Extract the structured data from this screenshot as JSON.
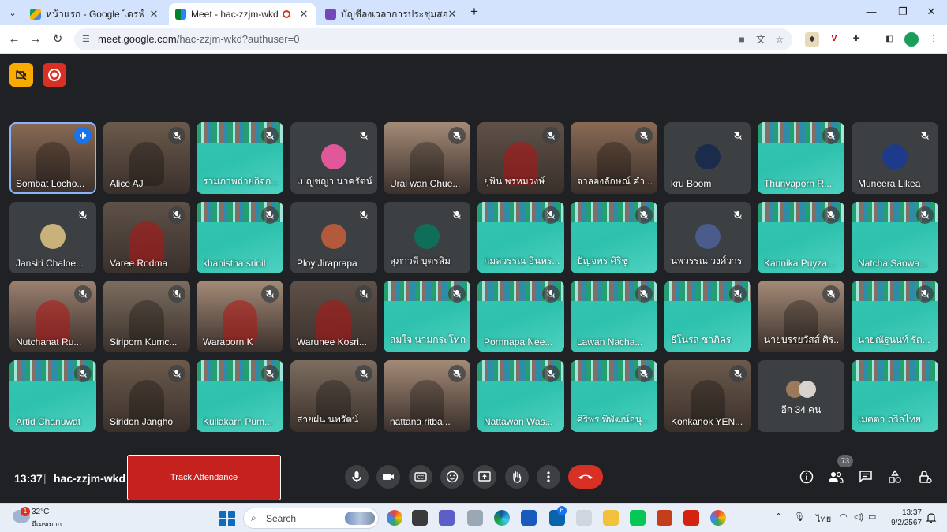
{
  "browser": {
    "tabs": [
      {
        "title": "หน้าแรก - Google ไดรฟ์",
        "favicon_color": "#1e8e3e",
        "active": false
      },
      {
        "title": "Meet - hac-zzjm-wkd",
        "favicon_color": "#00832d",
        "active": true
      },
      {
        "title": "บัญชีลงเวลาการประชุมสอบ CEFR ปี",
        "favicon_color": "#7248b9",
        "active": false
      }
    ],
    "url_host": "meet.google.com",
    "url_path": "/hac-zzjm-wkd?authuser=0"
  },
  "meet": {
    "participants": [
      {
        "name": "Sombat Locho...",
        "kind": "cam",
        "speaking": true
      },
      {
        "name": "Alice AJ",
        "kind": "cam"
      },
      {
        "name": "รวมภาพถ่ายกิจก...",
        "kind": "slide"
      },
      {
        "name": "เบญชญา นาครัตน์",
        "kind": "avatar",
        "avatar_color": "#e2579a"
      },
      {
        "name": "Urai wan Chue...",
        "kind": "cam"
      },
      {
        "name": "ยุพิน พรหมวงษ์",
        "kind": "cam",
        "red": true
      },
      {
        "name": "จาลองลักษณ์ คำ...",
        "kind": "cam"
      },
      {
        "name": "kru Boom",
        "kind": "avatar",
        "avatar_color": "#1a2b4c"
      },
      {
        "name": "Thunyaporn R...",
        "kind": "slide"
      },
      {
        "name": "Muneera Likea",
        "kind": "avatar",
        "avatar_color": "#1e3a8a"
      },
      {
        "name": "Jansiri Chaloe...",
        "kind": "avatar",
        "avatar_color": "#c9b27a"
      },
      {
        "name": "Varee Rodma",
        "kind": "cam",
        "red": true
      },
      {
        "name": "khanistha srinil",
        "kind": "slide"
      },
      {
        "name": "Ploy Jiraprapa",
        "kind": "avatar",
        "avatar_color": "#b35a3c"
      },
      {
        "name": "สุภาวดี บุตรสิม",
        "kind": "avatar",
        "avatar_color": "#0f6e59"
      },
      {
        "name": "กมลวรรณ อินทร...",
        "kind": "slide"
      },
      {
        "name": "ปัญจพร ศิริชู",
        "kind": "slide"
      },
      {
        "name": "นพวรรณ วงศ์วาร",
        "kind": "avatar",
        "avatar_color": "#4a5b8c"
      },
      {
        "name": "Kannika Puyza...",
        "kind": "slide"
      },
      {
        "name": "Natcha Saowa...",
        "kind": "slide"
      },
      {
        "name": "Nutchanat Ru...",
        "kind": "cam",
        "red": true
      },
      {
        "name": "Siriporn Kumc...",
        "kind": "cam"
      },
      {
        "name": "Waraporn K",
        "kind": "cam",
        "red": true
      },
      {
        "name": "Warunee Kosri...",
        "kind": "cam",
        "red": true
      },
      {
        "name": "สมใจ นามกระโทก",
        "kind": "slide"
      },
      {
        "name": "Pornnapa Nee...",
        "kind": "slide"
      },
      {
        "name": "Lawan Nacha...",
        "kind": "slide"
      },
      {
        "name": "ธีโนรส ชาภิคร",
        "kind": "slide"
      },
      {
        "name": "นายบรรยวัสส์ ศิร...",
        "kind": "cam"
      },
      {
        "name": "นายณัฐนนท์ รัต...",
        "kind": "slide"
      },
      {
        "name": "Artid Chanuwat",
        "kind": "slide"
      },
      {
        "name": "Siridon Jangho",
        "kind": "cam"
      },
      {
        "name": "Kullakarn Pum...",
        "kind": "slide"
      },
      {
        "name": "สายฝน นพรัตน์",
        "kind": "cam"
      },
      {
        "name": "nattana ritba...",
        "kind": "cam"
      },
      {
        "name": "Nattawan Was...",
        "kind": "slide"
      },
      {
        "name": "ศิริพร พิพัฒน์อนุ...",
        "kind": "slide"
      },
      {
        "name": "Konkanok YEN...",
        "kind": "cam"
      },
      {
        "name": "อีก 34 คน",
        "kind": "more"
      },
      {
        "name": "เมตตา ถวิลไทย",
        "kind": "slide"
      }
    ],
    "time": "13:37",
    "meeting_code": "hac-zzjm-wkd",
    "track_attendance_label": "Track Attendance",
    "people_count": "73"
  },
  "taskbar": {
    "temp": "32°C",
    "condition": "มีเมฆมาก",
    "weather_alert": "1",
    "search_label": "Search",
    "outlook_badge": "6",
    "language": "ไทย",
    "clock_time": "13:37",
    "clock_date": "9/2/2567"
  }
}
